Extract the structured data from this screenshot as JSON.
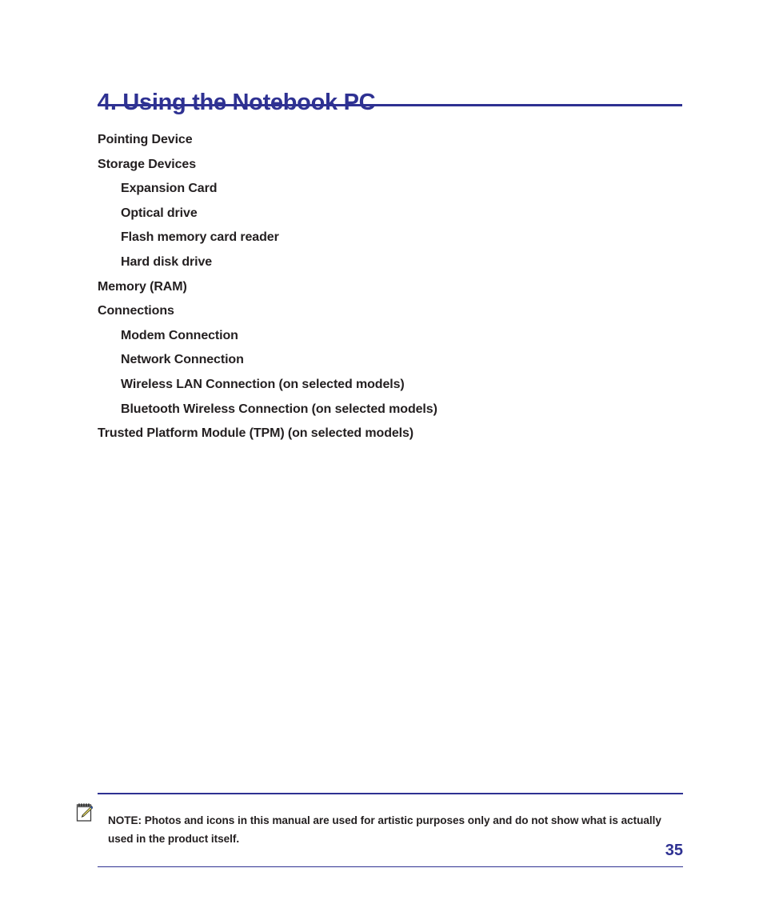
{
  "page": {
    "heading": "4. Using the Notebook PC",
    "page_number": "35",
    "accent_color": "#2E3192",
    "text_color": "#231F20"
  },
  "toc": {
    "items": [
      {
        "label": "Pointing Device",
        "level": 1
      },
      {
        "label": "Storage Devices",
        "level": 1
      },
      {
        "label": "Expansion Card",
        "level": 2
      },
      {
        "label": "Optical drive",
        "level": 2
      },
      {
        "label": "Flash memory card reader",
        "level": 2
      },
      {
        "label": "Hard disk drive",
        "level": 2
      },
      {
        "label": "Memory (RAM)",
        "level": 1
      },
      {
        "label": "Connections",
        "level": 1
      },
      {
        "label": "Modem Connection",
        "level": 2
      },
      {
        "label": "Network Connection",
        "level": 2
      },
      {
        "label": "Wireless LAN Connection (on selected models)",
        "level": 2
      },
      {
        "label": "Bluetooth Wireless Connection (on selected models)",
        "level": 2
      },
      {
        "label": "Trusted Platform Module (TPM) (on selected models)",
        "level": 1
      }
    ]
  },
  "note": {
    "icon": "notepad-pencil-icon",
    "text": "NOTE: Photos and icons in this manual are used for artistic purposes only and do not show what is actually used in the product itself."
  }
}
